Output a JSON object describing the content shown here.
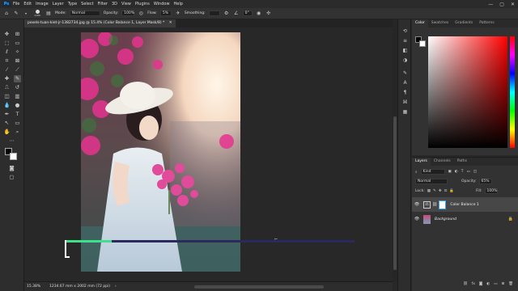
{
  "menu": [
    "File",
    "Edit",
    "Image",
    "Layer",
    "Type",
    "Select",
    "Filter",
    "3D",
    "View",
    "Plugins",
    "Window",
    "Help"
  ],
  "app_logo": "Ps",
  "window_controls": [
    "—",
    "▢",
    "✕"
  ],
  "options": {
    "brush_size": "1100",
    "mode_label": "Mode:",
    "mode_value": "Normal",
    "opacity_label": "Opacity:",
    "opacity_value": "100%",
    "flow_label": "Flow:",
    "flow_value": "5%",
    "smoothing_label": "Smoothing:",
    "angle_value": "0°"
  },
  "doc_tab": "pexels-tuan-kiet-jr-1382734.jpg @ 15.4% (Color Balance 1, Layer Mask/8) *",
  "status": {
    "zoom": "15.38%",
    "size": "1234.67 mm x 2002 mm (72 ppi)"
  },
  "colors": {
    "accent": "#31a8ff",
    "progress_green": "#3fe08a",
    "progress_track": "#2a2a5e",
    "canvas_bg": "#282828",
    "panel_bg": "#323232"
  },
  "color_panel": {
    "tabs": [
      "Color",
      "Swatches",
      "Gradients",
      "Patterns"
    ],
    "active_tab": "Color"
  },
  "layers_panel": {
    "tabs": [
      "Layers",
      "Channels",
      "Paths"
    ],
    "active_tab": "Layers",
    "kind_label": "Kind",
    "blend_mode": "Normal",
    "opacity_label": "Opacity:",
    "opacity_value": "65%",
    "lock_label": "Lock:",
    "fill_label": "Fill:",
    "fill_value": "100%",
    "layers": [
      {
        "name": "Color Balance 1",
        "selected": true
      },
      {
        "name": "Background",
        "selected": false
      }
    ]
  },
  "overlay_progress": 0.16
}
